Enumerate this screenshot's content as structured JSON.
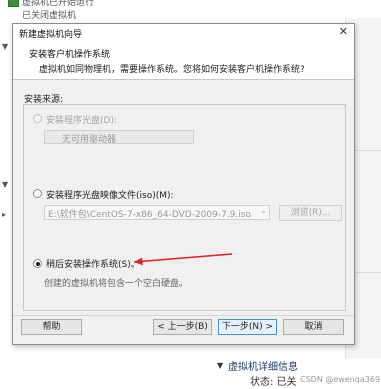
{
  "background": {
    "top_line1": "虚拟机已开始运行",
    "top_line2": "已关闭虚拟机",
    "bottom_section_label": "虚拟机详细信息",
    "bottom_sub": "状态: 已关",
    "watermark": "CSDN @ewenqa3697"
  },
  "dialog": {
    "title": "新建虚拟机向导",
    "header_title": "安装客户机操作系统",
    "header_desc": "虚拟机如同物理机，需要操作系统。您将如何安装客户机操作系统?",
    "section_label": "安装来源:",
    "options": {
      "disc": {
        "label": "安装程序光盘(D):",
        "selected": false,
        "enabled": false,
        "dropdown_value": "无可用驱动器"
      },
      "iso": {
        "label": "安装程序光盘映像文件(iso)(M):",
        "selected": false,
        "enabled": true,
        "path_value": "E:\\软件包\\CentOS-7-x86_64-DVD-2009-7.9.iso",
        "browse_label": "浏览(R)..."
      },
      "later": {
        "label": "稍后安装操作系统(S)。",
        "selected": true,
        "enabled": true,
        "hint": "创建的虚拟机将包含一个空白硬盘。"
      }
    },
    "buttons": {
      "help": "帮助",
      "back": "< 上一步(B)",
      "next": "下一步(N) >",
      "cancel": "取消"
    }
  },
  "colors": {
    "annotation_arrow": "#e02020",
    "dialog_bg": "#f0f0f0",
    "primary_border": "#4a8fd8"
  }
}
